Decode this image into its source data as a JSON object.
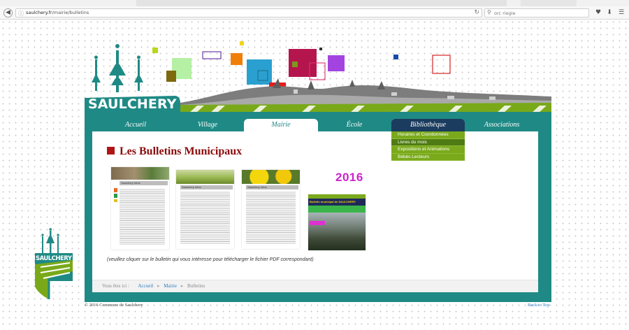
{
  "browser": {
    "url_host": "saulchery.fr",
    "url_path": "/mairie/bulletins",
    "search_placeholder": "orc riegie",
    "colors": {
      "toolbar": "#f7f7f7",
      "border": "#d6d6d6"
    }
  },
  "site": {
    "name": "SAULCHERY",
    "name_small": "SAULCHERY",
    "colors": {
      "teal": "#1f8a85",
      "navy": "#1b3c5e",
      "green": "#7aaa1c",
      "title_red": "#8b0b0b",
      "magenta": "#cc22cc"
    }
  },
  "nav": {
    "items": [
      {
        "label": "Accueil"
      },
      {
        "label": "Village"
      },
      {
        "label": "Mairie"
      },
      {
        "label": "École"
      },
      {
        "label": "Bibliothèque"
      },
      {
        "label": "Associations"
      }
    ],
    "active": "Mairie",
    "open_dropdown": "Bibliothèque"
  },
  "dropdown": {
    "items": [
      {
        "label": "Horaires et Coordonnées"
      },
      {
        "label": "Livres du mois"
      },
      {
        "label": "Expositions et Animations"
      },
      {
        "label": "Bébés Lecteurs"
      }
    ]
  },
  "page": {
    "title": "Les Bulletins Municipaux",
    "year_label": "2016",
    "instruction": "(veuillez cliquer sur le bulletin qui vous intéresse pour télécharger le fichier PDF correspondant)"
  },
  "bulletins": [
    {
      "header": "Saulchery Infos"
    },
    {
      "header": "Saulchery Infos"
    },
    {
      "header": "Saulchery Infos"
    },
    {
      "header": "Bulletin municipal de SAULCHERY"
    }
  ],
  "breadcrumb": {
    "prefix": "Vous êtes ici :",
    "items": [
      "Accueil",
      "Mairie",
      "Bulletins"
    ]
  },
  "footer": {
    "copyright": "© 2016 Commune de Saulchery",
    "back_to_top": "Back to Top"
  }
}
